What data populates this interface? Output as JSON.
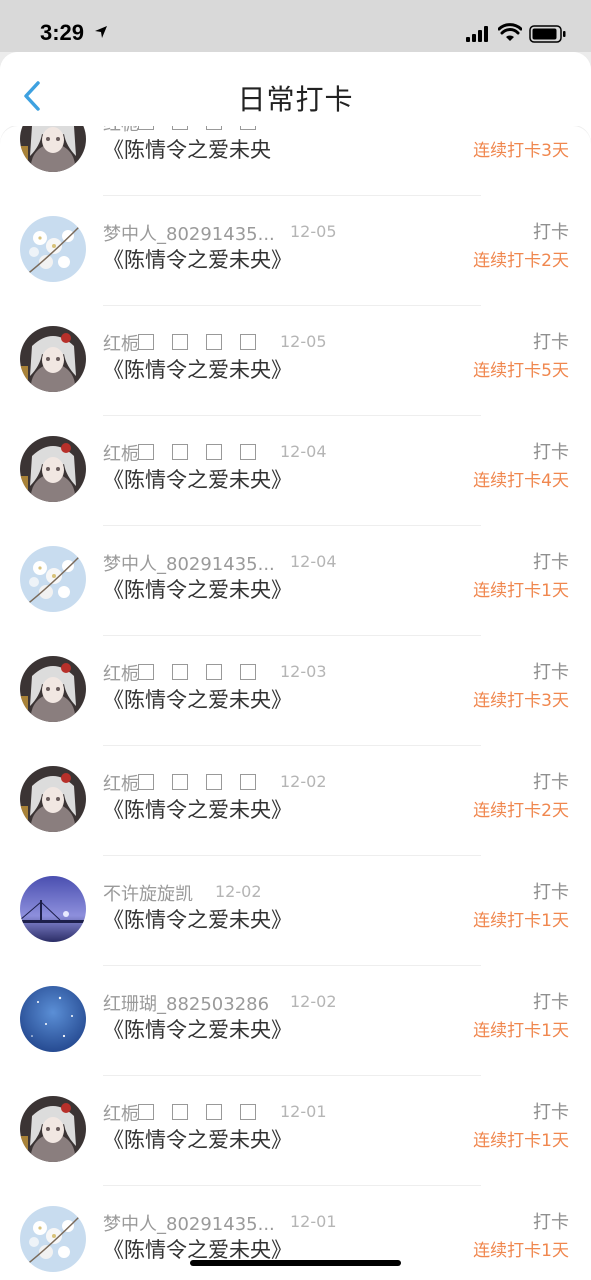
{
  "status": {
    "time": "3:29"
  },
  "nav": {
    "title": "日常打卡",
    "back_icon": "chevron-left-icon"
  },
  "colors": {
    "accent": "#3ea1e0",
    "streak": "#f0874e"
  },
  "rows": [
    {
      "name": "红栀",
      "squares": true,
      "date": "",
      "book": "《陈情令之爱未央",
      "action": "",
      "streak": "连续打卡3天",
      "avatar": "anime-avatar"
    },
    {
      "name": "梦中人_80291435...",
      "squares": false,
      "date": "12-05",
      "book": "《陈情令之爱未央》",
      "action": "打卡",
      "streak": "连续打卡2天",
      "avatar": "blossom-avatar"
    },
    {
      "name": "红栀",
      "squares": true,
      "date": "12-05",
      "book": "《陈情令之爱未央》",
      "action": "打卡",
      "streak": "连续打卡5天",
      "avatar": "anime-avatar"
    },
    {
      "name": "红栀",
      "squares": true,
      "date": "12-04",
      "book": "《陈情令之爱未央》",
      "action": "打卡",
      "streak": "连续打卡4天",
      "avatar": "anime-avatar"
    },
    {
      "name": "梦中人_80291435...",
      "squares": false,
      "date": "12-04",
      "book": "《陈情令之爱未央》",
      "action": "打卡",
      "streak": "连续打卡1天",
      "avatar": "blossom-avatar"
    },
    {
      "name": "红栀",
      "squares": true,
      "date": "12-03",
      "book": "《陈情令之爱未央》",
      "action": "打卡",
      "streak": "连续打卡3天",
      "avatar": "anime-avatar"
    },
    {
      "name": "红栀",
      "squares": true,
      "date": "12-02",
      "book": "《陈情令之爱未央》",
      "action": "打卡",
      "streak": "连续打卡2天",
      "avatar": "anime-avatar"
    },
    {
      "name": "不许旋旋凯",
      "squares": false,
      "date": "12-02",
      "book": "《陈情令之爱未央》",
      "action": "打卡",
      "streak": "连续打卡1天",
      "avatar": "night-bridge-avatar"
    },
    {
      "name": "红珊瑚_882503286",
      "squares": false,
      "date": "12-02",
      "book": "《陈情令之爱未央》",
      "action": "打卡",
      "streak": "连续打卡1天",
      "avatar": "starry-sky-avatar"
    },
    {
      "name": "红栀",
      "squares": true,
      "date": "12-01",
      "book": "《陈情令之爱未央》",
      "action": "打卡",
      "streak": "连续打卡1天",
      "avatar": "anime-avatar"
    },
    {
      "name": "梦中人_80291435...",
      "squares": false,
      "date": "12-01",
      "book": "《陈情令之爱未央》",
      "action": "打卡",
      "streak": "连续打卡1天",
      "avatar": "blossom-avatar"
    }
  ]
}
